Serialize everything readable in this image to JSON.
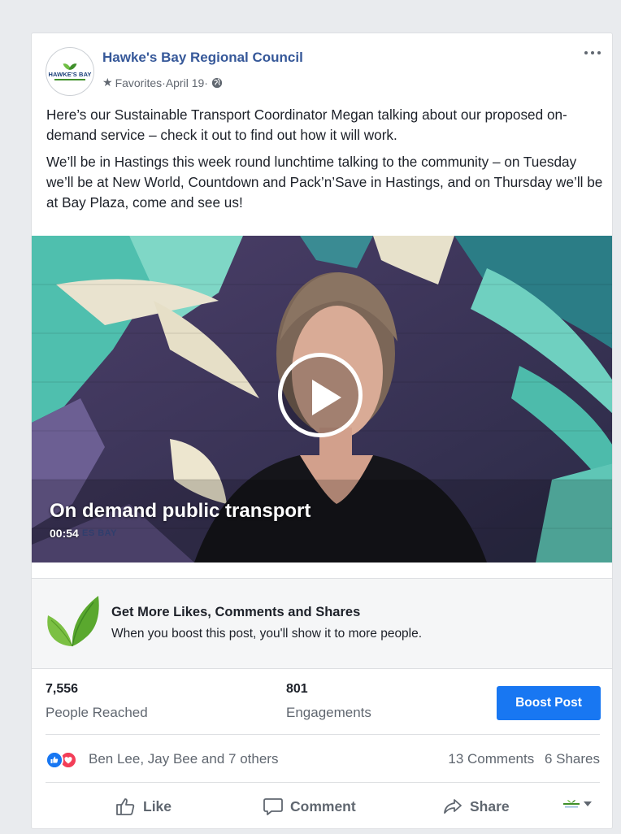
{
  "post": {
    "page_name": "Hawke's Bay Regional Council",
    "avatar_logo_text": "HAWKE'S BAY",
    "audience_label": "Favorites",
    "date": "April 19",
    "separator": " · ",
    "paragraphs": [
      "Here’s our Sustainable Transport Coordinator Megan talking about our proposed on-demand service – check it out to find out how it will work.",
      "We’ll be in Hastings this week round lunchtime talking to the community – on Tuesday we’ll be at New World, Countdown and Pack’n’Save in Hastings, and on Thursday we’ll be at Bay Plaza, come and see us!"
    ]
  },
  "video": {
    "title": "On demand public transport",
    "duration": "00:54",
    "watermark": "ES BAY"
  },
  "promo": {
    "title": "Get More Likes, Comments and Shares",
    "description": "When you boost this post, you'll show it to more people."
  },
  "stats": {
    "reach_value": "7,556",
    "reach_label": "People Reached",
    "engagements_value": "801",
    "engagements_label": "Engagements",
    "boost_label": "Boost Post"
  },
  "reactions": {
    "summary": "Ben Lee, Jay Bee and 7 others",
    "comments": "13 Comments",
    "shares": "6 Shares"
  },
  "actions": {
    "like": "Like",
    "comment": "Comment",
    "share": "Share"
  },
  "colors": {
    "link": "#365899",
    "boost": "#1877f2",
    "like_reaction": "#1877f2",
    "love_reaction": "#f33e58"
  },
  "icons": [
    "more-options-icon",
    "star-icon",
    "globe-icon",
    "play-icon",
    "leaf-icon",
    "like-icon",
    "comment-icon",
    "share-icon",
    "chevron-down-icon"
  ]
}
